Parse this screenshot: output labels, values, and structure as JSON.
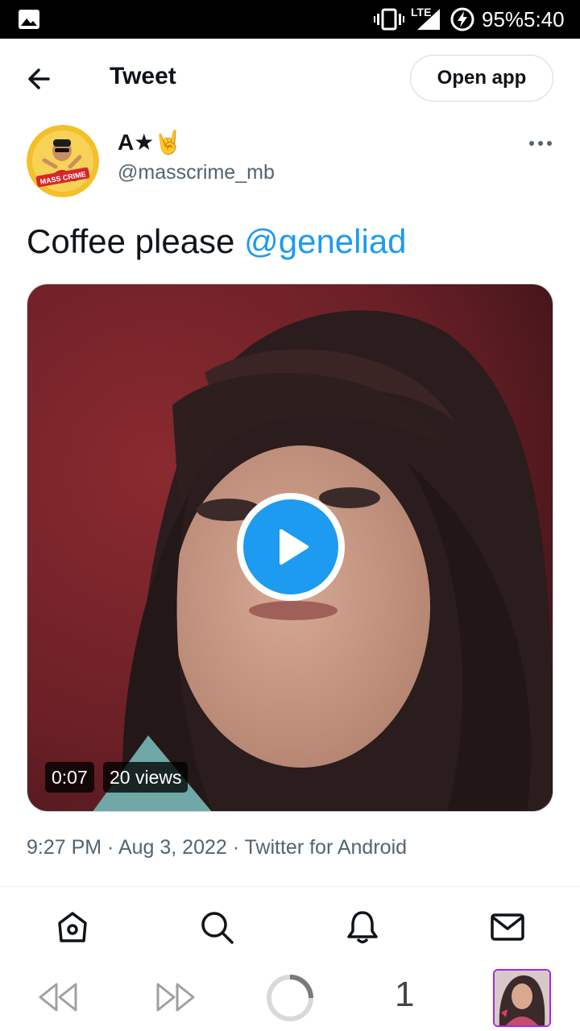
{
  "status_bar": {
    "network": "LTE",
    "battery": "95%",
    "time": "5:40",
    "icons": [
      "gallery-icon",
      "vibrate-icon",
      "signal-icon",
      "battery-charging-icon"
    ]
  },
  "header": {
    "title": "Tweet",
    "open_app_label": "Open app"
  },
  "tweet": {
    "display_name": "A★🤘",
    "handle": "@masscrime_mb",
    "avatar_label": "MASS CRIME",
    "text": "Coffee please ",
    "mention": "@geneliad",
    "video": {
      "duration": "0:07",
      "views": "20 views"
    },
    "meta": "9:27 PM · Aug 3, 2022 · Twitter for Android"
  },
  "bottom_nav": [
    "home-icon",
    "search-icon",
    "notifications-icon",
    "messages-icon"
  ],
  "browser_bar": {
    "tab_count": "1",
    "icons": [
      "rewind-icon",
      "fast-forward-icon",
      "loading-icon",
      "tab-thumbnail"
    ]
  },
  "colors": {
    "accent": "#1d9bf0",
    "text_primary": "#0f1419",
    "text_secondary": "#536471",
    "border": "#cfd9de"
  }
}
